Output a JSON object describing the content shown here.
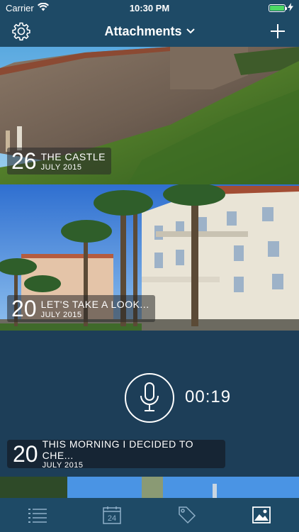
{
  "status_bar": {
    "carrier": "Carrier",
    "time": "10:30 PM"
  },
  "nav": {
    "title": "Attachments"
  },
  "entries": [
    {
      "day": "26",
      "title": "THE CASTLE",
      "subtitle": "JULY 2015"
    },
    {
      "day": "20",
      "title": "LET'S TAKE A LOOK...",
      "subtitle": "JULY 2015"
    },
    {
      "day": "20",
      "title": "THIS MORNING I DECIDED TO CHE...",
      "subtitle": "JULY 2015",
      "duration": "00:19"
    }
  ],
  "tab_bar": {
    "calendar_day": "24"
  },
  "colors": {
    "bar": "#1e4a66",
    "background": "#1d3e58",
    "battery": "#4cd964"
  }
}
